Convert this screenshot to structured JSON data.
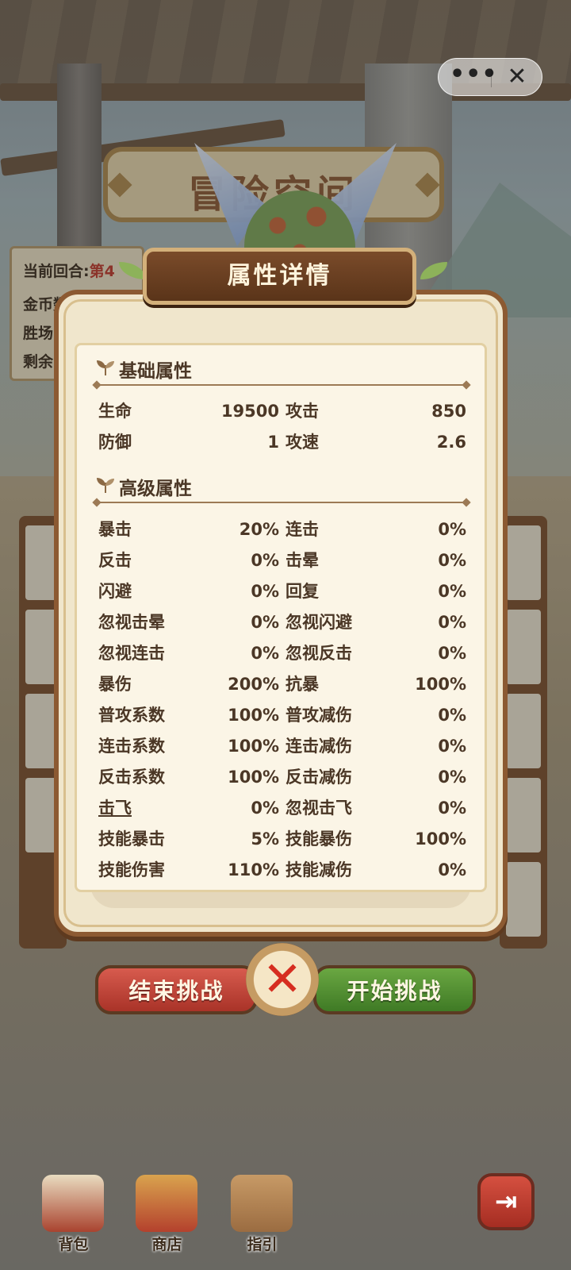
{
  "capsule": {
    "more_label": "•••",
    "close_label": "✕"
  },
  "banner": {
    "title": "冒险空间"
  },
  "info_panel": {
    "round_label": "当前回合:",
    "round_value": "第4",
    "coins_label": "金币数:",
    "wins_label": "胜场",
    "remaining_label": "剩余"
  },
  "popup": {
    "title": "属性详情",
    "basic": {
      "title": "基础属性",
      "rows": [
        {
          "a_name": "生命",
          "a_value": "19500",
          "b_name": "攻击",
          "b_value": "850"
        },
        {
          "a_name": "防御",
          "a_value": "1",
          "b_name": "攻速",
          "b_value": "2.6"
        }
      ]
    },
    "advanced": {
      "title": "高级属性",
      "rows": [
        {
          "a_name": "暴击",
          "a_value": "20%",
          "b_name": "连击",
          "b_value": "0%"
        },
        {
          "a_name": "反击",
          "a_value": "0%",
          "b_name": "击晕",
          "b_value": "0%"
        },
        {
          "a_name": "闪避",
          "a_value": "0%",
          "b_name": "回复",
          "b_value": "0%"
        },
        {
          "a_name": "忽视击晕",
          "a_value": "0%",
          "b_name": "忽视闪避",
          "b_value": "0%"
        },
        {
          "a_name": "忽视连击",
          "a_value": "0%",
          "b_name": "忽视反击",
          "b_value": "0%"
        },
        {
          "a_name": "暴伤",
          "a_value": "200%",
          "b_name": "抗暴",
          "b_value": "100%"
        },
        {
          "a_name": "普攻系数",
          "a_value": "100%",
          "b_name": "普攻减伤",
          "b_value": "0%"
        },
        {
          "a_name": "连击系数",
          "a_value": "100%",
          "b_name": "连击减伤",
          "b_value": "0%"
        },
        {
          "a_name": "反击系数",
          "a_value": "100%",
          "b_name": "反击减伤",
          "b_value": "0%"
        },
        {
          "a_name": "击飞",
          "a_value": "0%",
          "b_name": "忽视击飞",
          "b_value": "0%"
        },
        {
          "a_name": "技能暴击",
          "a_value": "5%",
          "b_name": "技能暴伤",
          "b_value": "100%"
        },
        {
          "a_name": "技能伤害",
          "a_value": "110%",
          "b_name": "技能减伤",
          "b_value": "0%"
        }
      ]
    },
    "close_glyph": "✕"
  },
  "actions": {
    "end_label": "结束挑战",
    "start_label": "开始挑战"
  },
  "nav": {
    "bag_label": "背包",
    "shop_label": "商店",
    "guide_label": "指引",
    "exit_glyph": "⇥"
  },
  "colors": {
    "popup_bg": "#f0e6cc",
    "popup_border": "#8c5a32",
    "text": "#4b3726",
    "end_button": "#c0443a",
    "start_button": "#55902f",
    "close_x": "#d62d20"
  }
}
